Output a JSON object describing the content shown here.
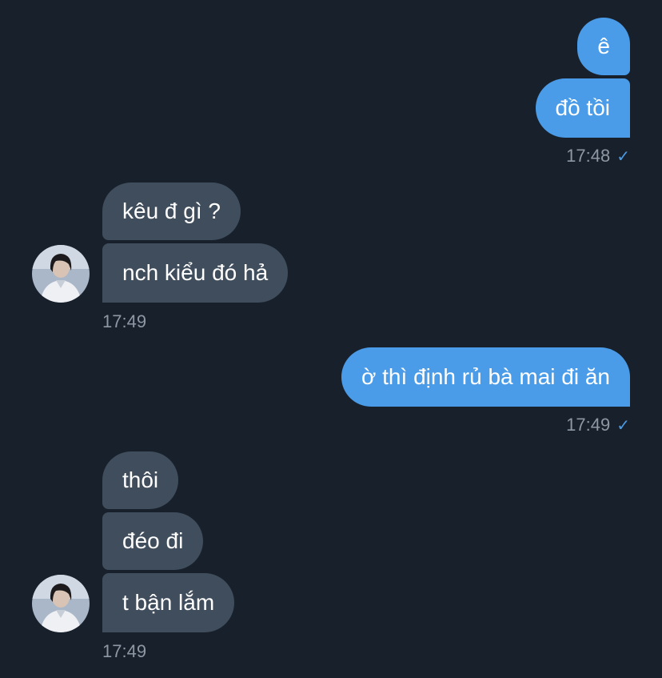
{
  "messages": [
    {
      "text": "ê"
    },
    {
      "text": "đồ tồi"
    },
    {
      "text": "kêu đ gì ?"
    },
    {
      "text": "nch kiểu đó hả"
    },
    {
      "text": "ờ thì định rủ bà mai đi ăn"
    },
    {
      "text": "thôi"
    },
    {
      "text": "đéo đi"
    },
    {
      "text": "t bận lắm"
    }
  ],
  "timestamps": {
    "t1": "17:48",
    "t2": "17:49",
    "t3": "17:49",
    "t4": "17:49"
  },
  "check_glyph": "✓",
  "colors": {
    "background": "#18202b",
    "outgoing_bubble": "#4a9ce8",
    "incoming_bubble": "#3f4d5c",
    "timestamp": "#8e98a5"
  }
}
